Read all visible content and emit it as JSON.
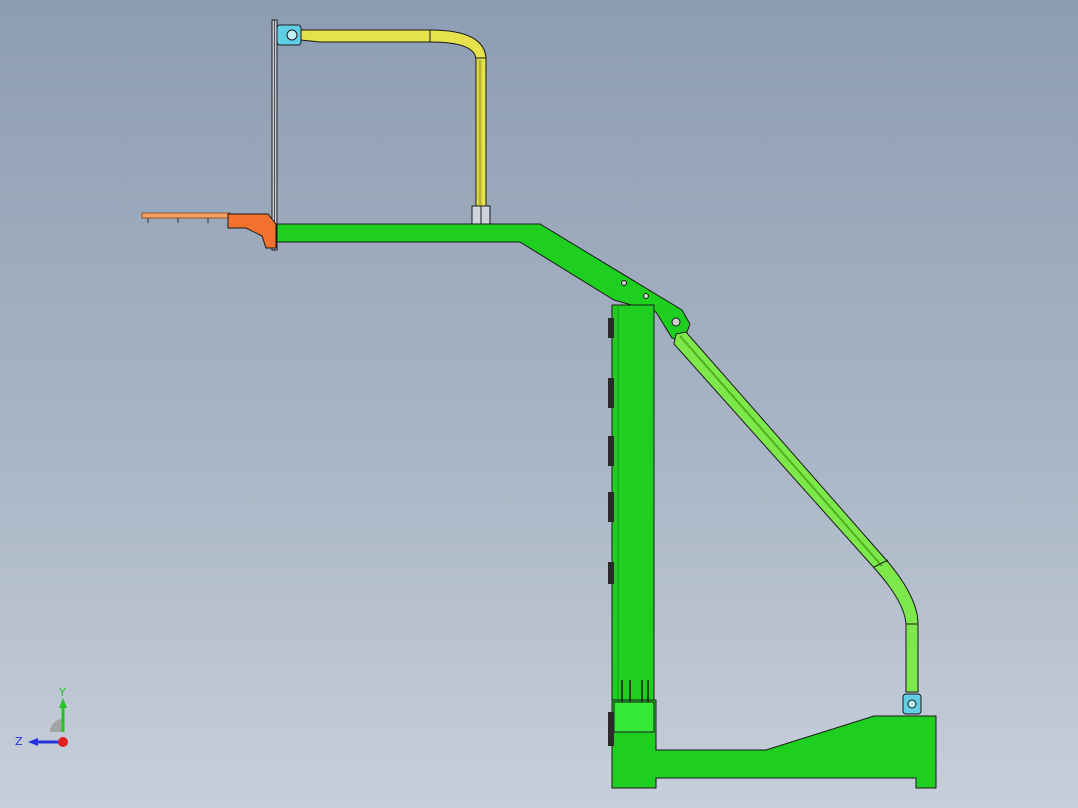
{
  "viewport": {
    "background_top": "#8d9db2",
    "background_bottom": "#c7cfda"
  },
  "model": {
    "colors": {
      "frame_green": "#1fcf1f",
      "brace_green": "#7de84a",
      "arm_yellow": "#e5e24c",
      "bracket_orange": "#f2712c",
      "hinge_cyan": "#5fcfe6",
      "edge": "#1a1a1a"
    }
  },
  "triad": {
    "y_label": "Y",
    "z_label": "Z",
    "y_color": "#22c422",
    "z_color": "#2233dd",
    "x_color": "#e02020"
  }
}
